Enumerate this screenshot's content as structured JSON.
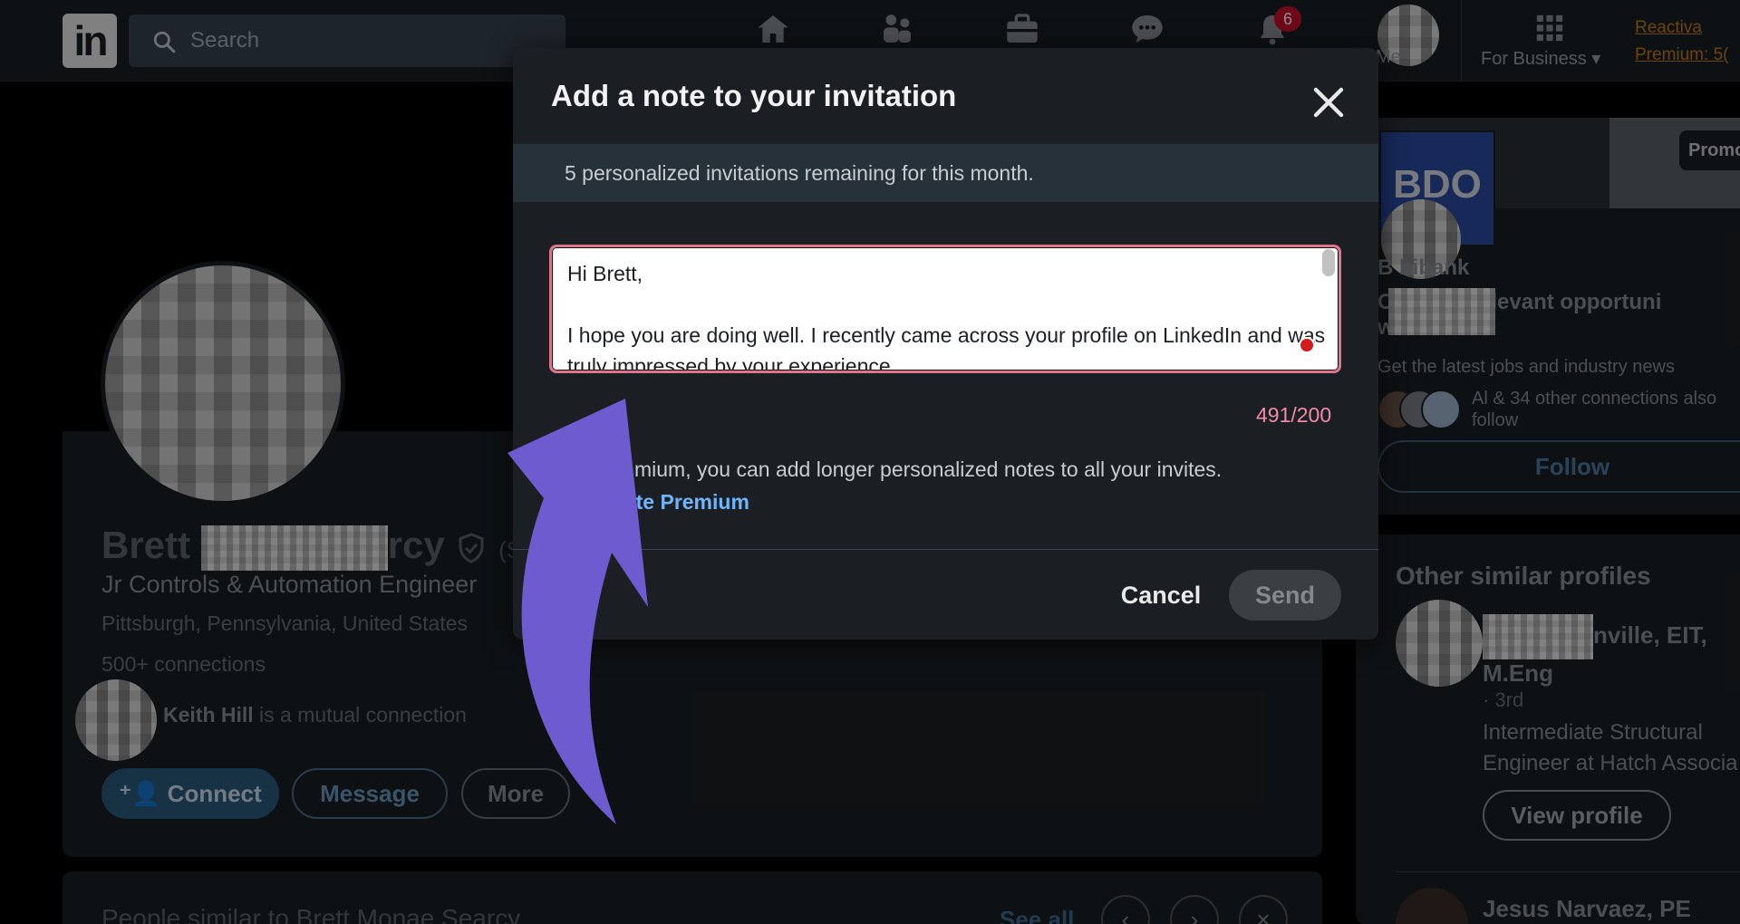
{
  "nav": {
    "search_placeholder": "Search",
    "notifications_count": "6",
    "me_label": "Me",
    "for_business": "For Business",
    "promo_line1": "Reactiva",
    "promo_line2": "Premium: 5("
  },
  "profile": {
    "first_name": "Brett",
    "name_suffix": "rcy",
    "pronoun_hint": "(Sh",
    "headline": "Jr Controls & Automation Engineer",
    "location": "Pittsburgh, Pennsylvania, United States",
    "connections": "500+ connections",
    "mutual_name": "Keith Hill",
    "mutual_text": " is a mutual connection",
    "connect_label": "Connect",
    "message_label": "Message",
    "more_label": "More"
  },
  "people_similar": {
    "title": "People similar to Brett Monae Searcy",
    "see_all": "See all"
  },
  "ad": {
    "promo_tag": "Promo",
    "logo_text": "BDO",
    "company": "B        hibank",
    "text_line1": "C        xplore relevant opportuni",
    "text_line2": "w        hibank",
    "subtext": "Get the latest jobs and industry news",
    "follow_text": "Al & 34 other connections also follow",
    "follow_label": "Follow"
  },
  "similar_profiles": {
    "title": "Other similar profiles",
    "item1_name_suffix": "nville, EIT, M.Eng",
    "item1_degree": "· 3rd",
    "item1_desc": "Intermediate Structural Engineer at Hatch Associa",
    "view_profile_label": "View profile",
    "item2_name": "Jesus Narvaez, PE"
  },
  "modal": {
    "title": "Add a note to your invitation",
    "banner": "5 personalized invitations remaining for this month.",
    "note_value": "Hi Brett,\n\nI hope you are doing well. I recently came across your profile on LinkedIn and was truly impressed by your experience",
    "char_count": "491/200",
    "upsell_text": "mium, you can add longer personalized notes to all your invites.",
    "reactivate_label": "tivate Premium",
    "cancel_label": "Cancel",
    "send_label": "Send"
  },
  "colors": {
    "accent_link": "#70b5f9",
    "error_pink": "#f08ba3",
    "annotation_arrow": "#6e5bd0"
  }
}
